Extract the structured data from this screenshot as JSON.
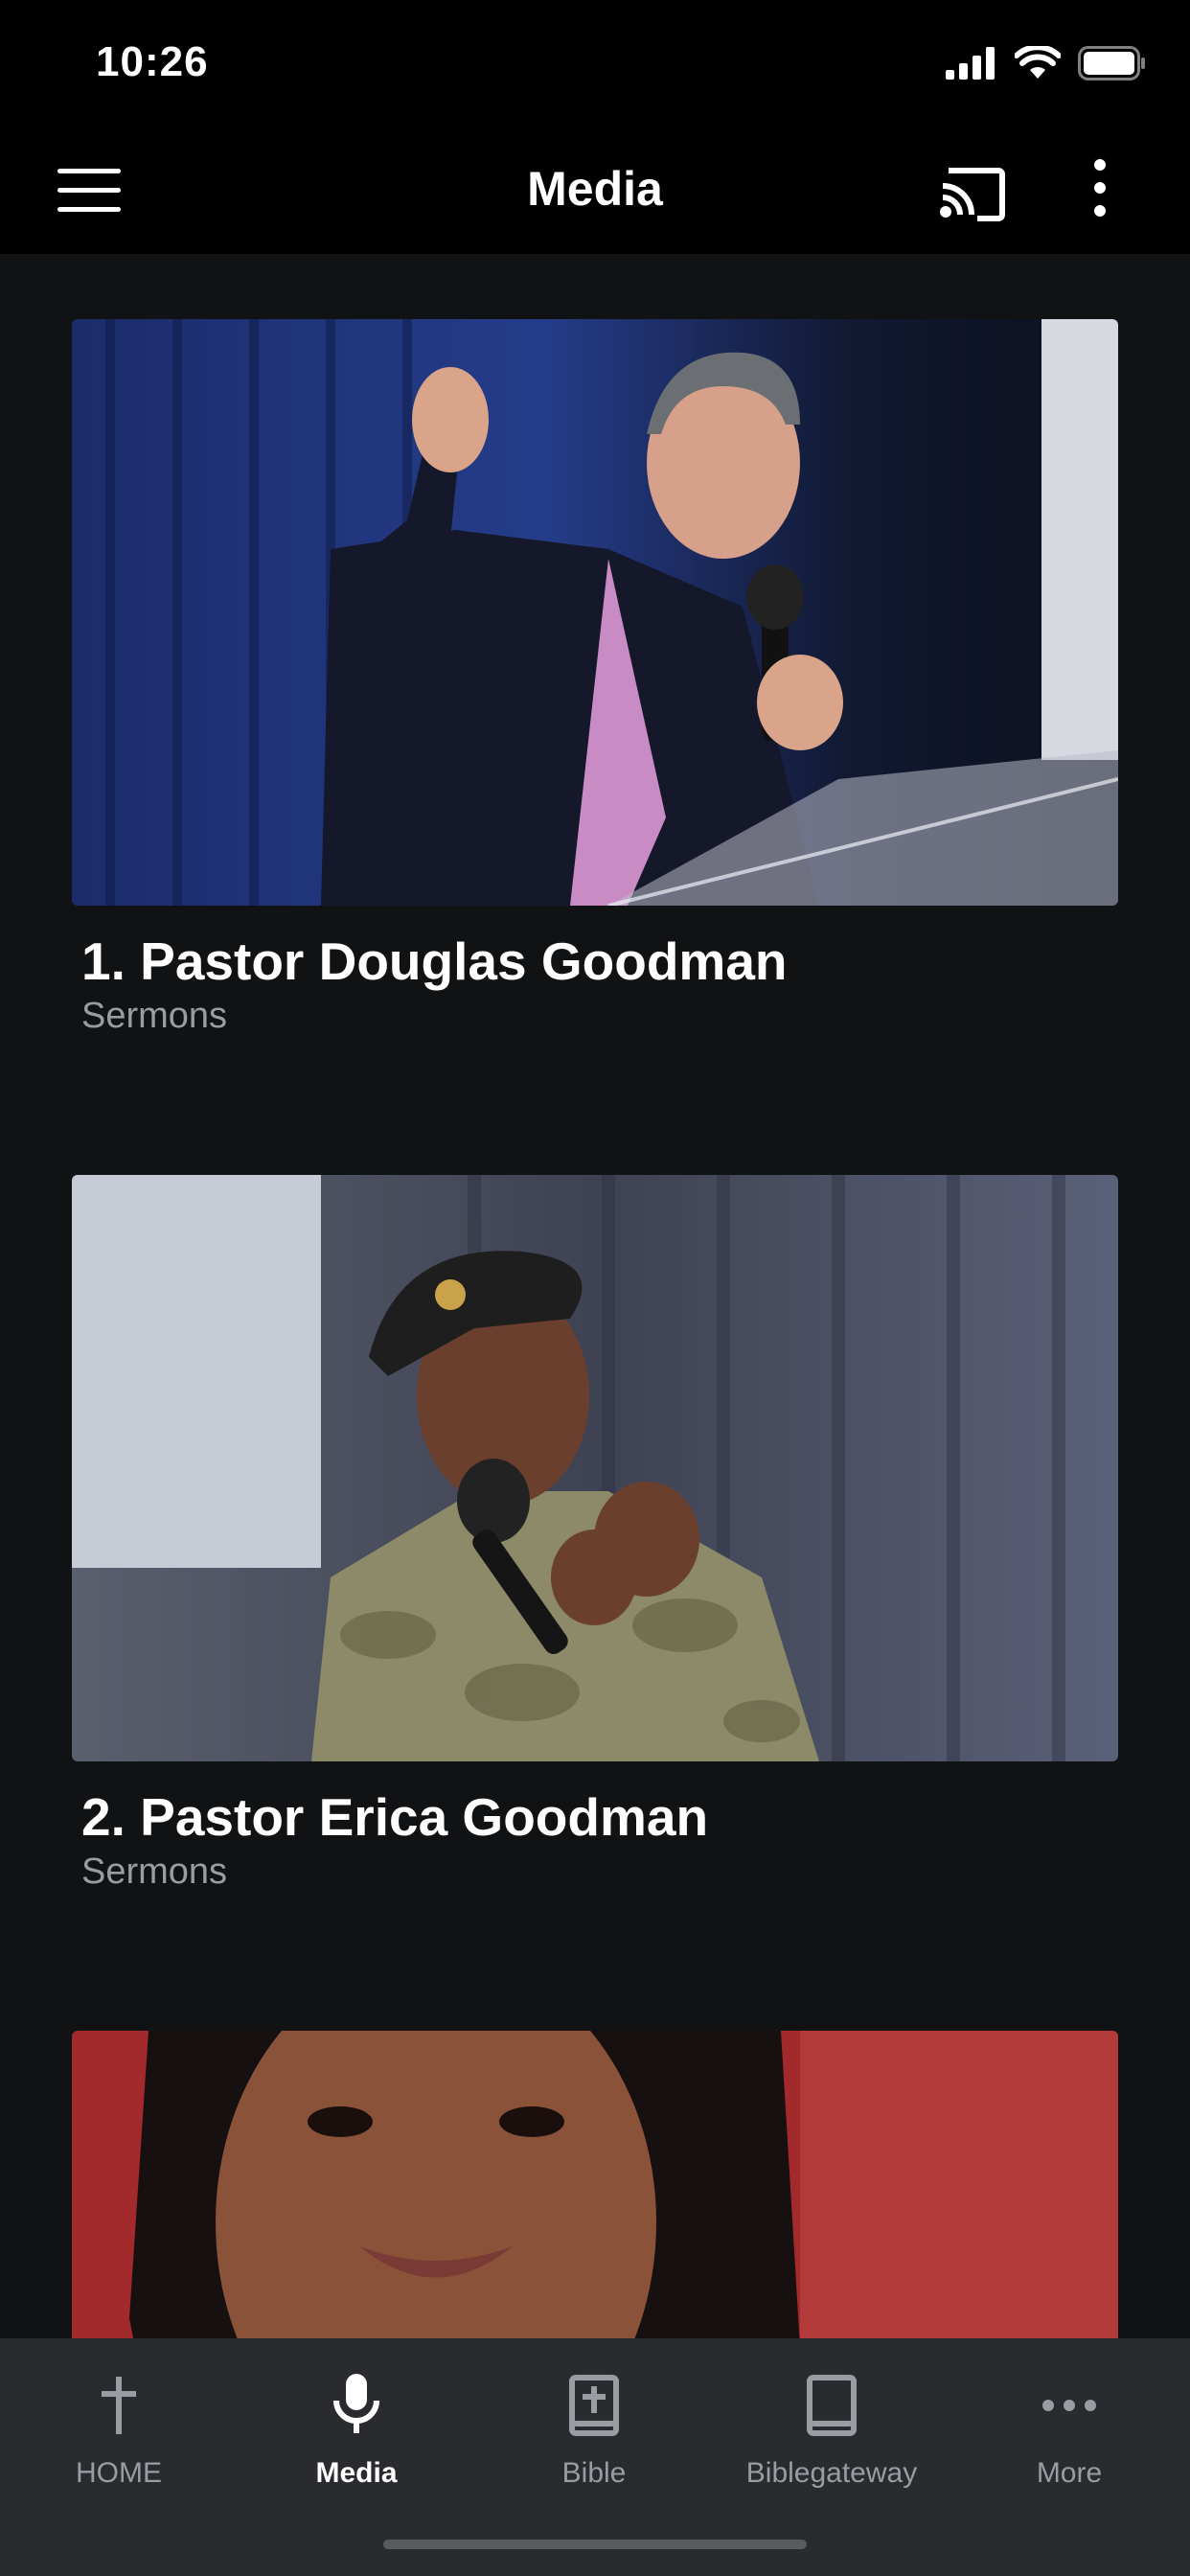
{
  "status": {
    "time": "10:26"
  },
  "app_bar": {
    "title": "Media"
  },
  "items": [
    {
      "title": "1. Pastor Douglas Goodman",
      "subtitle": "Sermons"
    },
    {
      "title": "2. Pastor Erica Goodman",
      "subtitle": "Sermons"
    },
    {
      "title": "",
      "subtitle": ""
    }
  ],
  "nav": [
    {
      "label": "HOME",
      "icon": "cross-icon"
    },
    {
      "label": "Media",
      "icon": "microphone-icon",
      "active": true
    },
    {
      "label": "Bible",
      "icon": "bible-icon"
    },
    {
      "label": "Biblegateway",
      "icon": "book-icon"
    },
    {
      "label": "More",
      "icon": "more-horizontal-icon"
    }
  ]
}
